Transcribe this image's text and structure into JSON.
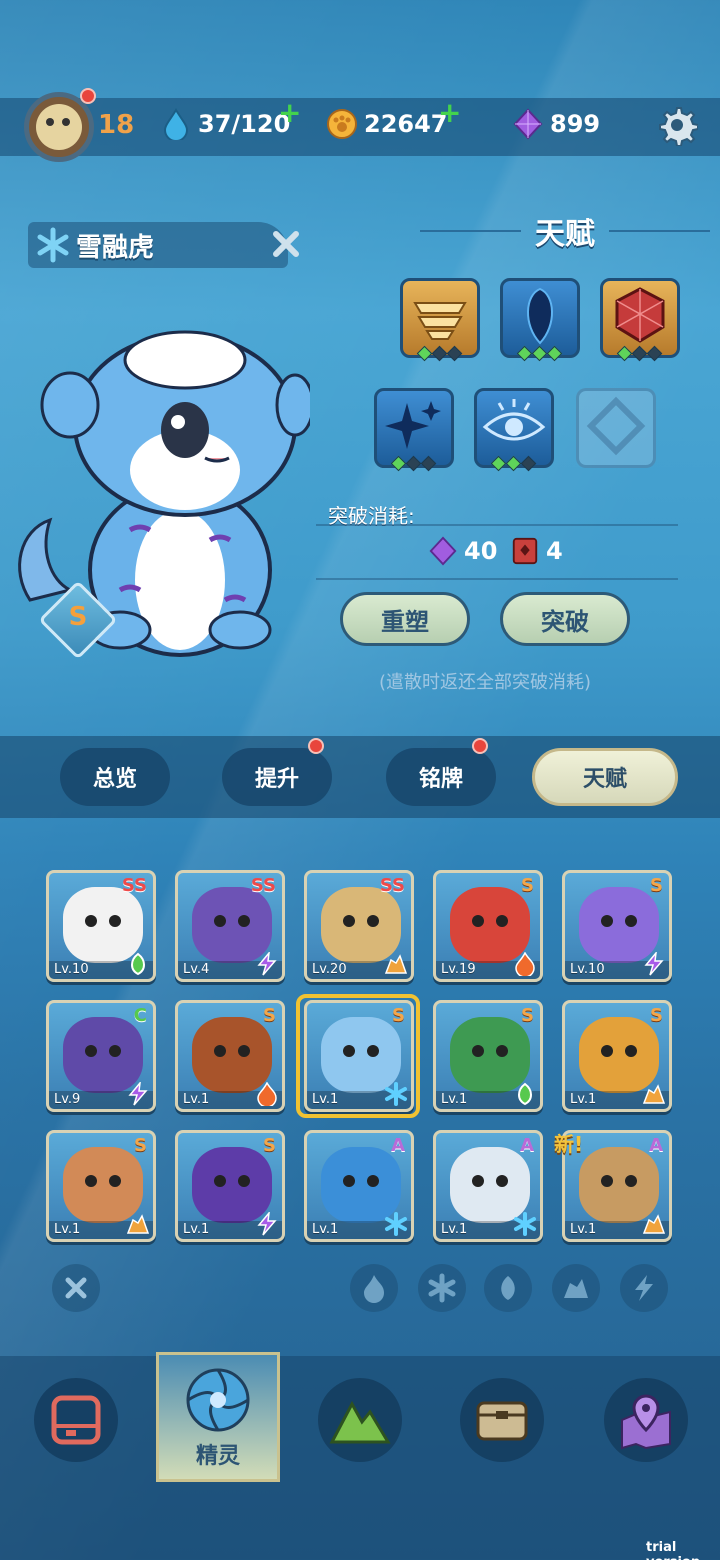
{
  "header": {
    "level": "18",
    "energy": "37/120",
    "coins": "22647",
    "gems": "899"
  },
  "creature": {
    "name": "雪融虎",
    "rank": "S"
  },
  "talent": {
    "title": "天赋",
    "breakthrough_cost_label": "突破消耗:",
    "cost_gem": "40",
    "cost_book": "4",
    "reshape_label": "重塑",
    "breakthrough_label": "突破",
    "note": "(遣散时返还全部突破消耗)",
    "slots": [
      {
        "icon": "gold-wings-icon",
        "gems": [
          true,
          false,
          false
        ]
      },
      {
        "icon": "blue-drop-icon",
        "gems": [
          true,
          true,
          true
        ]
      },
      {
        "icon": "red-gem-icon",
        "gems": [
          true,
          false,
          false
        ]
      },
      {
        "icon": "sparkle-icon",
        "gems": [
          true,
          false,
          false
        ]
      },
      {
        "icon": "eye-icon",
        "gems": [
          true,
          true,
          false
        ]
      },
      {
        "icon": "locked-slot-icon",
        "gems": []
      }
    ]
  },
  "tabs": [
    "总览",
    "提升",
    "铭牌",
    "天赋"
  ],
  "active_tab": "天赋",
  "cards": [
    {
      "name": "panda",
      "grade": "SS",
      "lv": "Lv.10",
      "el": "leaf",
      "color": "#f2f2f2"
    },
    {
      "name": "purple-croc",
      "grade": "SS",
      "lv": "Lv.4",
      "el": "bolt",
      "color": "#6d53b5"
    },
    {
      "name": "skull-dino",
      "grade": "SS",
      "lv": "Lv.20",
      "el": "rock",
      "color": "#d9b777"
    },
    {
      "name": "red-horn",
      "grade": "S",
      "lv": "Lv.19",
      "el": "fire",
      "color": "#d8453a"
    },
    {
      "name": "jellyfish",
      "grade": "S",
      "lv": "Lv.10",
      "el": "bolt",
      "color": "#8b6cdb"
    },
    {
      "name": "purple-croc-c",
      "grade": "C",
      "lv": "Lv.9",
      "el": "bolt",
      "color": "#5f4aa8"
    },
    {
      "name": "boiler",
      "grade": "S",
      "lv": "Lv.1",
      "el": "fire",
      "color": "#a8542b"
    },
    {
      "name": "snow-tiger",
      "grade": "S",
      "lv": "Lv.1",
      "el": "snow",
      "color": "#8fc7ef"
    },
    {
      "name": "snake",
      "grade": "S",
      "lv": "Lv.1",
      "el": "leaf",
      "color": "#3e9a52"
    },
    {
      "name": "sunflower",
      "grade": "S",
      "lv": "Lv.1",
      "el": "rock",
      "color": "#e3a13a"
    },
    {
      "name": "fox-dog",
      "grade": "S",
      "lv": "Lv.1",
      "el": "rock",
      "color": "#d28a57"
    },
    {
      "name": "purple-cat",
      "grade": "S",
      "lv": "Lv.1",
      "el": "bolt",
      "color": "#5d3ca8"
    },
    {
      "name": "blue-fish",
      "grade": "A",
      "lv": "Lv.1",
      "el": "snow",
      "color": "#3b8fd8"
    },
    {
      "name": "owl",
      "grade": "A",
      "lv": "Lv.1",
      "el": "snow",
      "color": "#dfe9f2"
    },
    {
      "name": "potato",
      "grade": "A",
      "lv": "Lv.1",
      "el": "rock",
      "color": "#c79b62"
    }
  ],
  "new_tag": "新!",
  "nav_active_label": "精灵",
  "trial": "trial version"
}
